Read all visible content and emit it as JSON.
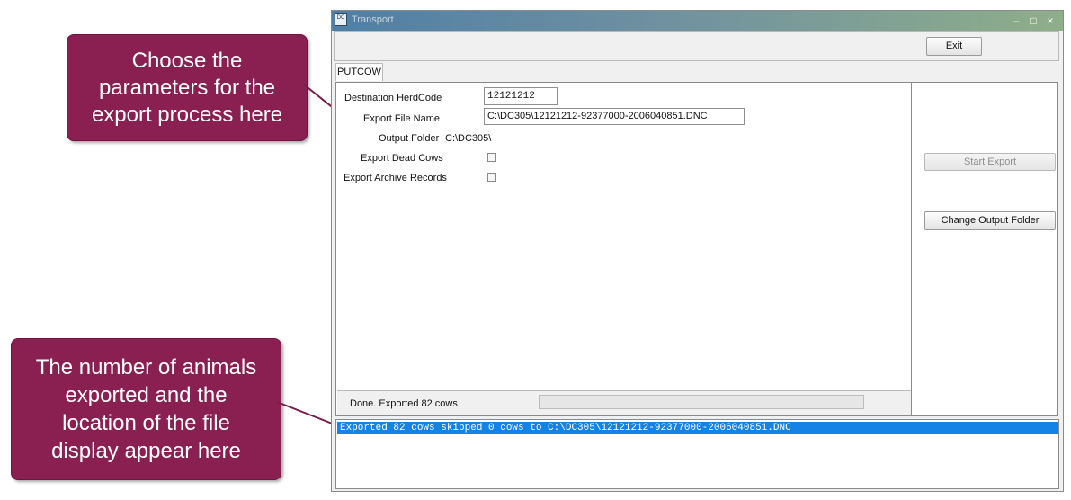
{
  "callouts": {
    "top": [
      "Choose the",
      "parameters for the",
      "export process here"
    ],
    "bottom": [
      "The number of animals",
      "exported and the",
      "location of the file",
      "display appear here"
    ],
    "fill_color": "#8a1f52"
  },
  "window": {
    "title": "Transport",
    "icon_text": "DC",
    "controls": {
      "minimize": "–",
      "maximize": "□",
      "close": "×"
    }
  },
  "toolbar": {
    "exit_label": "Exit"
  },
  "tabs": [
    {
      "label": "PUTCOW"
    }
  ],
  "form": {
    "destination_herdcode": {
      "label": "Destination HerdCode",
      "value": "12121212"
    },
    "export_file_name": {
      "label": "Export File Name",
      "value": "C:\\DC305\\12121212-92377000-2006040851.DNC"
    },
    "output_folder": {
      "label": "Output Folder",
      "value": "C:\\DC305\\"
    },
    "export_dead_cows": {
      "label": "Export Dead Cows",
      "checked": false
    },
    "export_archive_records": {
      "label": "Export Archive Records",
      "checked": false
    }
  },
  "status": {
    "text": "Done. Exported 82 cows",
    "progress": 0
  },
  "side": {
    "start_export_label": "Start Export",
    "change_output_folder_label": "Change Output Folder"
  },
  "log": [
    "Exported 82 cows skipped 0 cows to C:\\DC305\\12121212-92377000-2006040851.DNC"
  ],
  "colors": {
    "selection": "#1583e6",
    "title_gradient_start": "#4f7fa6",
    "title_gradient_end": "#8fae8a"
  }
}
